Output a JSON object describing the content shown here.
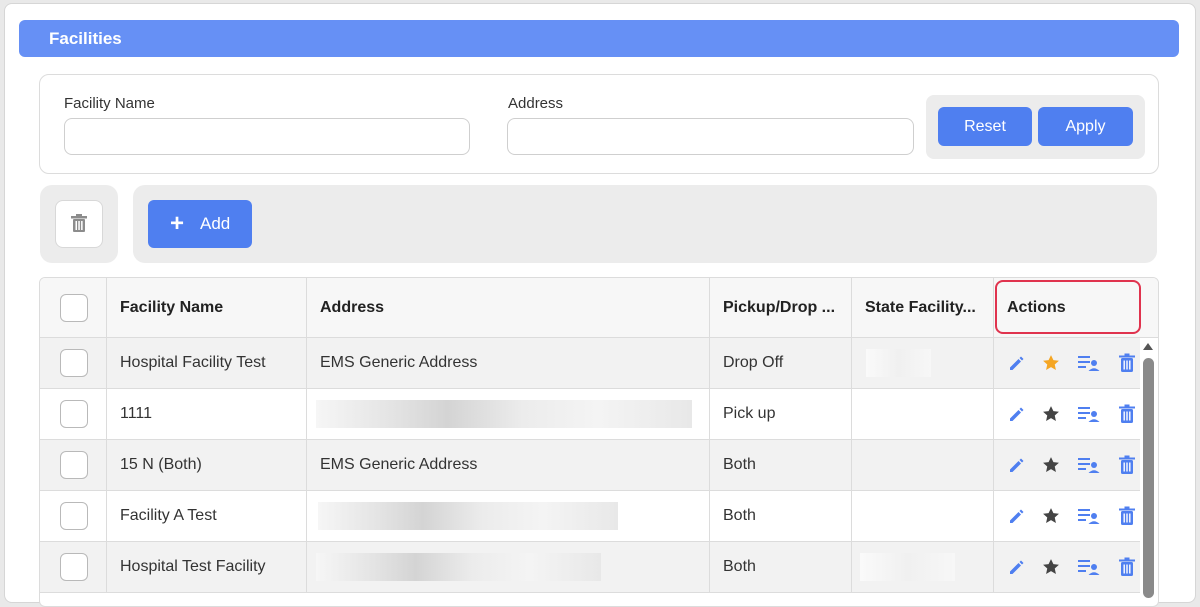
{
  "panel": {
    "title": "Facilities"
  },
  "filters": {
    "facility_name_label": "Facility Name",
    "facility_name_value": "",
    "address_label": "Address",
    "address_value": "",
    "reset_label": "Reset",
    "apply_label": "Apply"
  },
  "toolbar": {
    "delete_icon": "trash-icon",
    "add_label": "Add",
    "add_icon": "plus-icon"
  },
  "table": {
    "columns": [
      "Facility Name",
      "Address",
      "Pickup/Drop ...",
      "State Facility...",
      "Actions"
    ],
    "rows": [
      {
        "name": "Hospital Facility Test",
        "address": "EMS Generic Address",
        "pickup_drop": "Drop Off",
        "state_facility": "",
        "favorite": true
      },
      {
        "name": "1111",
        "address": "",
        "pickup_drop": "Pick up",
        "state_facility": "",
        "favorite": false
      },
      {
        "name": "15 N (Both)",
        "address": "EMS Generic Address",
        "pickup_drop": "Both",
        "state_facility": "",
        "favorite": false
      },
      {
        "name": "Facility A Test",
        "address": "",
        "pickup_drop": "Both",
        "state_facility": "",
        "favorite": false
      },
      {
        "name": "Hospital Test Facility",
        "address": "",
        "pickup_drop": "Both",
        "state_facility": "",
        "favorite": false
      }
    ]
  },
  "colors": {
    "accent": "#4f7ff0",
    "header": "#6690f5",
    "favorite": "#f5a623",
    "star": "#444444",
    "highlight": "#e0334e"
  }
}
